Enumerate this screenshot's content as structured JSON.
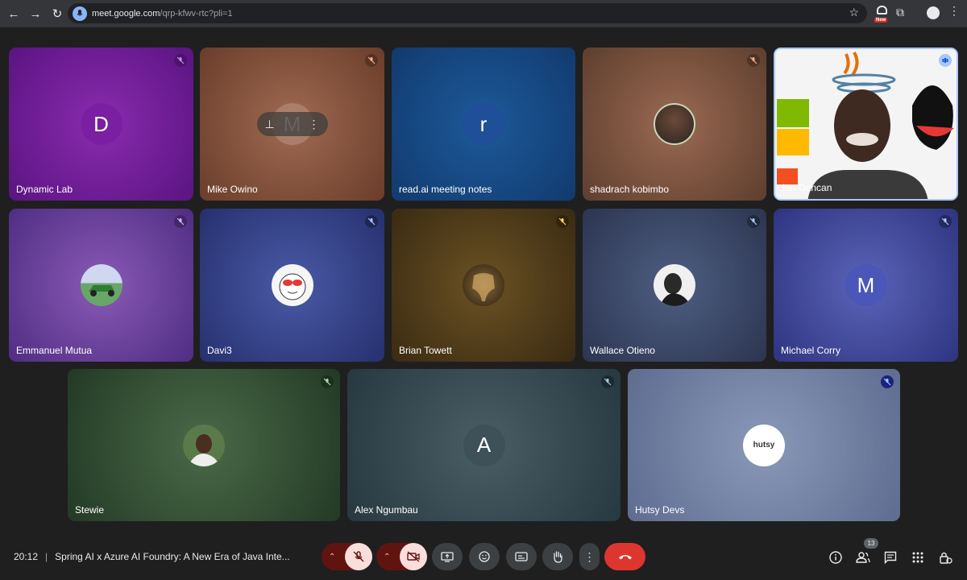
{
  "browser": {
    "url_host": "meet.google.com",
    "url_path": "/qrp-kfwv-rtc?pli=1",
    "ext_badge": "New"
  },
  "tiles": [
    {
      "name": "Dynamic Lab",
      "avatar_letter": "D"
    },
    {
      "name": "Mike Owino",
      "avatar_letter": "M"
    },
    {
      "name": "read.ai meeting notes",
      "avatar_letter": "r"
    },
    {
      "name": "shadrach kobimbo"
    },
    {
      "name": "Ian Dancan"
    },
    {
      "name": "Emmanuel Mutua"
    },
    {
      "name": "Davi3"
    },
    {
      "name": "Brian Towett"
    },
    {
      "name": "Wallace Otieno"
    },
    {
      "name": "Michael Corry",
      "avatar_letter": "M"
    },
    {
      "name": "Stewie"
    },
    {
      "name": "Alex Ngumbau",
      "avatar_letter": "A"
    },
    {
      "name": "Hutsy Devs",
      "logo_text": "hutsy"
    }
  ],
  "bottom_bar": {
    "time": "20:12",
    "separator": "|",
    "meeting_title": "Spring AI x Azure AI Foundry: A New Era of Java Inte...",
    "participants_count": "13"
  }
}
